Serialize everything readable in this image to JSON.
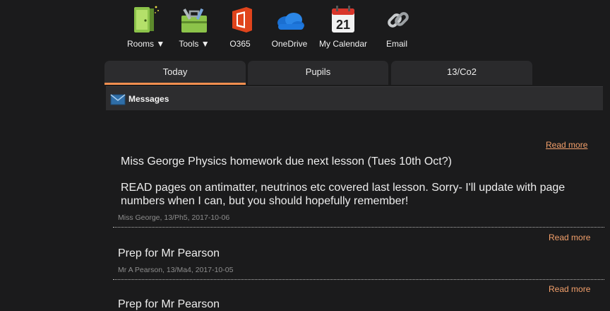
{
  "apps": [
    {
      "label": "Rooms ▼",
      "icon": "door-icon"
    },
    {
      "label": "Tools ▼",
      "icon": "toolbox-icon"
    },
    {
      "label": "O365",
      "icon": "office-icon"
    },
    {
      "label": "OneDrive",
      "icon": "cloud-icon"
    },
    {
      "label": "My Calendar",
      "icon": "calendar-icon",
      "day": "21"
    },
    {
      "label": "Email",
      "icon": "chain-link-icon"
    }
  ],
  "tabs": [
    {
      "label": "Today",
      "active": true
    },
    {
      "label": "Pupils",
      "active": false
    },
    {
      "label": "13/Co2",
      "active": false
    }
  ],
  "messages_header": {
    "title": "Messages",
    "icon": "envelope-icon"
  },
  "messages": [
    {
      "read_more": "Read more",
      "title": "Miss George Physics homework due next lesson (Tues 10th Oct?)",
      "body": "READ pages on antimatter, neutrinos etc covered last lesson. Sorry- I'll update with page numbers when I can, but you should hopefully remember!",
      "meta": "Miss George,  13/Ph5,  2017-10-06"
    },
    {
      "read_more": "Read more",
      "title": "Prep for Mr Pearson",
      "meta": "Mr A Pearson,  13/Ma4,  2017-10-05"
    },
    {
      "read_more": "Read more",
      "title": "Prep for Mr Pearson"
    }
  ],
  "colors": {
    "accent": "#f28f4f",
    "link": "#f3a06b",
    "background": "#1b1b1c"
  }
}
